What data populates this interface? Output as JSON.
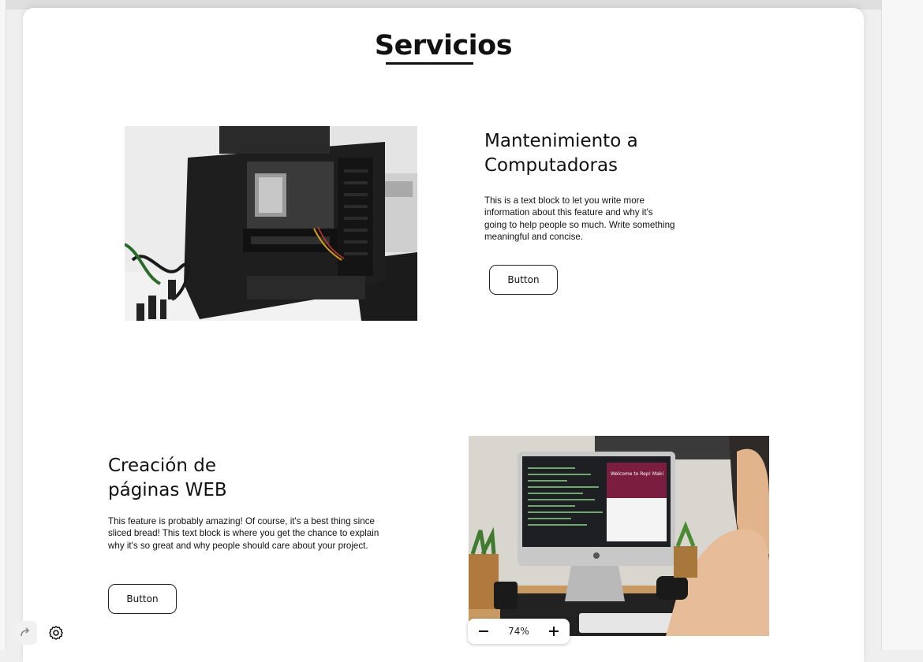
{
  "page": {
    "title": "Servicios"
  },
  "feature_1": {
    "heading": "Mantenimiento a Computadoras",
    "body": "This is a text block to let you write more information about this feature and why it's going to help people so much. Write something meaningful and concise.",
    "button_label": "Button",
    "image": "pc-build-photo"
  },
  "feature_2": {
    "heading": "Creación de páginas WEB",
    "body": "This feature is probably amazing! Of course, it's a best thing since sliced bread! This text block is where you get the chance to explain why it's so great and why people should care about your project.",
    "button_label": "Button",
    "image": "developer-imac-photo"
  },
  "zoom": {
    "level": "74%",
    "minus_icon": "minus-icon",
    "plus_icon": "plus-icon"
  },
  "toolbar": {
    "redo_icon": "redo-icon",
    "settings_icon": "gear-icon"
  },
  "colors": {
    "text": "#111111",
    "canvas": "#ffffff",
    "background": "#efefef"
  }
}
